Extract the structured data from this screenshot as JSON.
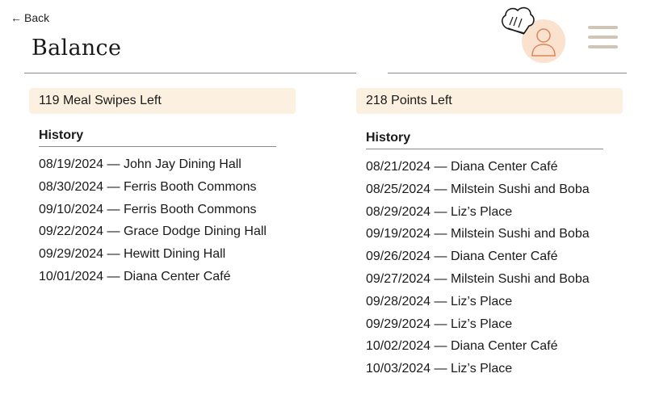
{
  "nav": {
    "back_arrow": "←",
    "back_label": "Back",
    "menu_icon": "hamburger-icon",
    "avatar_icon": "user-icon"
  },
  "page": {
    "title": "Balance"
  },
  "colors": {
    "card_bg": "#fcf0e1",
    "avatar_bg": "#fbe2cf",
    "avatar_stroke": "#d7865a",
    "menu_bars": "#cfc6b8"
  },
  "swipes": {
    "balance_label": "119 Meal Swipes Left",
    "history_title": "History",
    "history": [
      "08/19/2024 — John Jay Dining Hall",
      "08/30/2024 — Ferris Booth Commons",
      "09/10/2024 — Ferris Booth Commons",
      "09/22/2024 — Grace Dodge Dining Hall",
      "09/29/2024 — Hewitt Dining Hall",
      "10/01/2024 — Diana Center Café"
    ]
  },
  "points": {
    "balance_label": "218 Points Left",
    "history_title": "History",
    "history": [
      "08/21/2024 — Diana Center Café",
      "08/25/2024 — Milstein Sushi and Boba",
      "08/29/2024 — Liz’s Place",
      "09/19/2024 — Milstein Sushi and Boba",
      "09/26/2024 — Diana Center Café",
      "09/27/2024 — Milstein Sushi and Boba",
      "09/28/2024 — Liz’s Place",
      "09/29/2024 — Liz’s Place",
      "10/02/2024 — Diana Center Café",
      "10/03/2024 — Liz’s Place"
    ]
  }
}
